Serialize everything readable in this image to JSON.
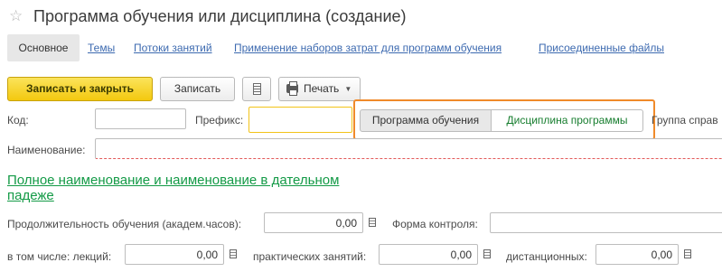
{
  "window": {
    "star_glyph": "☆",
    "title": "Программа обучения или дисциплина (создание)"
  },
  "tabs": [
    {
      "label": "Основное",
      "active": true
    },
    {
      "label": "Темы"
    },
    {
      "label": "Потоки занятий"
    },
    {
      "label": "Применение наборов затрат для программ обучения"
    },
    {
      "label": "Присоединенные файлы"
    }
  ],
  "toolbar": {
    "save_close_label": "Записать и закрыть",
    "save_label": "Записать",
    "print_label": "Печать"
  },
  "form": {
    "code_label": "Код:",
    "code_value": "",
    "prefix_label": "Префикс:",
    "prefix_value": "",
    "switch_option_1": "Программа обучения",
    "switch_option_2": "Дисциплина программы",
    "group_label": "Группа справ",
    "name_label": "Наименование:",
    "name_value": "",
    "full_name_link": "Полное наименование и наименование в дательном падеже",
    "duration_label": "Продолжительность обучения (академ.часов):",
    "duration_value": "0,00",
    "control_form_label": "Форма контроля:",
    "control_form_value": "",
    "lectures_label": "в том числе: лекций:",
    "lectures_value": "0,00",
    "practical_label": "практических занятий:",
    "practical_value": "0,00",
    "distance_label": "дистанционных:",
    "distance_value": "0,00"
  },
  "colors": {
    "accent_yellow": "#f3c80f",
    "highlight_orange": "#f08a2a",
    "link_blue": "#3d6ab0",
    "link_green": "#139a46"
  }
}
